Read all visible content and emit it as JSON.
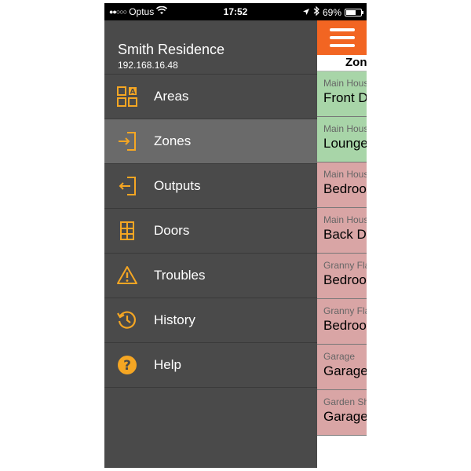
{
  "status_bar": {
    "carrier": "Optus",
    "signal": "●●○○○",
    "time": "17:52",
    "battery": "69%",
    "battery_level": 0.69
  },
  "drawer": {
    "title": "Smith Residence",
    "ip": "192.168.16.48",
    "items": [
      {
        "label": "Areas",
        "icon": "areas-icon"
      },
      {
        "label": "Zones",
        "icon": "zones-icon",
        "active": true
      },
      {
        "label": "Outputs",
        "icon": "outputs-icon"
      },
      {
        "label": "Doors",
        "icon": "doors-icon"
      },
      {
        "label": "Troubles",
        "icon": "warning-icon"
      },
      {
        "label": "History",
        "icon": "history-icon"
      },
      {
        "label": "Help",
        "icon": "help-icon"
      }
    ]
  },
  "content": {
    "tab_header": "Zones",
    "zones": [
      {
        "area": "Main House",
        "name": "Front Door",
        "status": "closed"
      },
      {
        "area": "Main House",
        "name": "Lounge",
        "status": "closed"
      },
      {
        "area": "Main House",
        "name": "Bedroom",
        "status": "open"
      },
      {
        "area": "Main House",
        "name": "Back Door",
        "status": "open"
      },
      {
        "area": "Granny Flat",
        "name": "Bedroom",
        "status": "open"
      },
      {
        "area": "Granny Flat",
        "name": "Bedroom",
        "status": "open"
      },
      {
        "area": "Garage",
        "name": "Garage",
        "status": "open"
      },
      {
        "area": "Garden Shed",
        "name": "Garage",
        "status": "open"
      }
    ]
  },
  "colors": {
    "accent": "#f26522",
    "icon": "#f5a623",
    "drawer_bg": "#4a4a4a",
    "active_bg": "#6a6a6a",
    "zone_closed": "#a8d5a8",
    "zone_open": "#d9a5a5"
  }
}
